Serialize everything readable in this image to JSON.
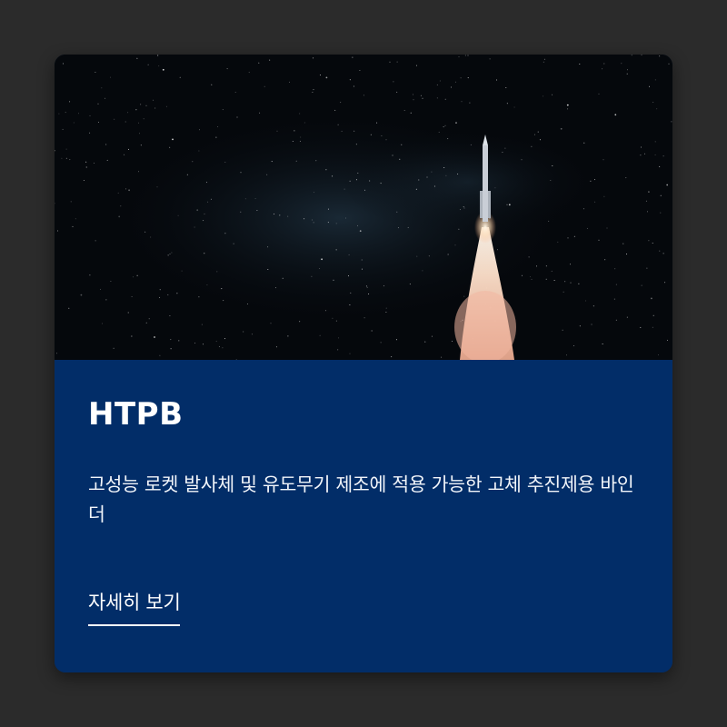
{
  "card": {
    "image_description": "rocket-launch-night-sky",
    "title": "HTPB",
    "description": "고성능 로켓 발사체 및 유도무기 제조에 적용 가능한 고체 추진제용 바인더",
    "link_label": "자세히 보기"
  },
  "colors": {
    "page_background": "#2b2b2b",
    "card_background": "#022d68",
    "text": "#ffffff"
  }
}
